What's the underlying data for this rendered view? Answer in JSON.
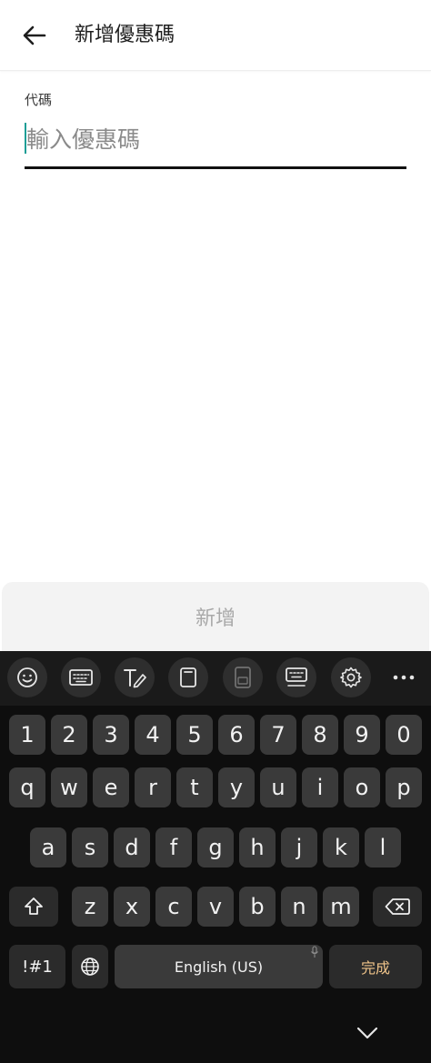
{
  "appbar": {
    "title": "新增優惠碼"
  },
  "form": {
    "code_label": "代碼",
    "code_placeholder": "輸入優惠碼",
    "code_value": ""
  },
  "submit": {
    "label": "新增"
  },
  "keyboard": {
    "toolbar_icons": [
      "emoji-icon",
      "keyboard-icon",
      "handwriting-icon",
      "clipboard-icon",
      "one-handed-icon",
      "keyboard-mode-icon",
      "settings-icon",
      "more-icon"
    ],
    "number_row": [
      "1",
      "2",
      "3",
      "4",
      "5",
      "6",
      "7",
      "8",
      "9",
      "0"
    ],
    "row1": [
      "q",
      "w",
      "e",
      "r",
      "t",
      "y",
      "u",
      "i",
      "o",
      "p"
    ],
    "row2": [
      "a",
      "s",
      "d",
      "f",
      "g",
      "h",
      "j",
      "k",
      "l"
    ],
    "row3": [
      "z",
      "x",
      "c",
      "v",
      "b",
      "n",
      "m"
    ],
    "symbols_label": "!#1",
    "space_label": "English (US)",
    "done_label": "完成",
    "colors": {
      "background": "#0e0e0e",
      "key": "#3a3a3a",
      "done_text": "#f0c48a"
    }
  }
}
